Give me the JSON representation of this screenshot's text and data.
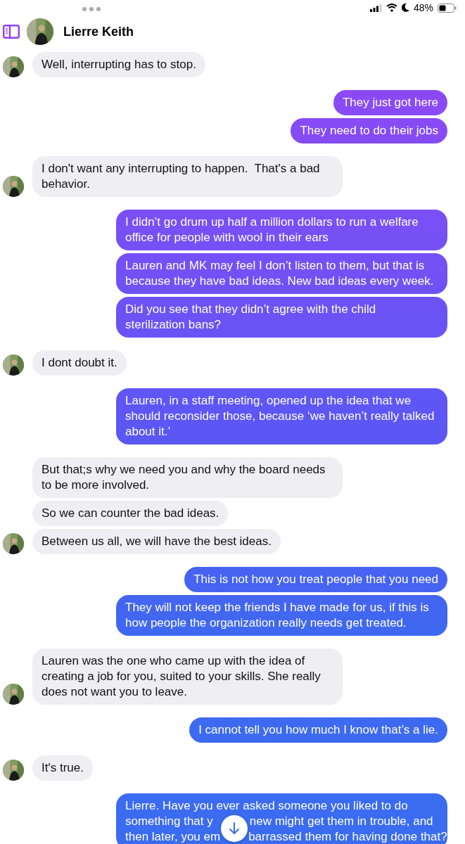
{
  "status_bar": {
    "battery": "48%"
  },
  "header": {
    "name": "Lierre Keith"
  },
  "messages": [
    {
      "kind": "incoming",
      "avatar": true,
      "text": "Well, interrupting has to stop."
    },
    {
      "kind": "outgoing",
      "text": "They just got here"
    },
    {
      "kind": "outgoing",
      "text": "They need to do their jobs"
    },
    {
      "kind": "incoming",
      "avatar": true,
      "text": "I don't want any interrupting to happen.  That's a bad behavior."
    },
    {
      "kind": "outgoing",
      "text": "I didn’t go drum up half a million dollars to run a welfare office for people with wool in their ears"
    },
    {
      "kind": "outgoing",
      "text": "Lauren and MK may feel I don’t listen to them, but that is because they have bad ideas. New bad ideas every week."
    },
    {
      "kind": "outgoing",
      "text": "Did you see that they didn’t agree with the child sterilization bans?"
    },
    {
      "kind": "incoming",
      "avatar": true,
      "text": "I dont doubt it."
    },
    {
      "kind": "outgoing",
      "text": "Lauren, in a staff meeting, opened up the idea that we should reconsider those, because ‘we haven’t really talked about it.’"
    },
    {
      "kind": "incoming",
      "avatar": false,
      "text": "But that;s why we need you and why the board needs to be more involved."
    },
    {
      "kind": "incoming",
      "avatar": false,
      "text": "So we can counter the bad ideas."
    },
    {
      "kind": "incoming",
      "avatar": true,
      "text": "Between us all, we will have the best ideas."
    },
    {
      "kind": "outgoing",
      "text": "This is not how you treat people that you need"
    },
    {
      "kind": "outgoing",
      "text": "They will not keep the friends I have made for us, if this is how people the organization really needs get treated."
    },
    {
      "kind": "incoming",
      "avatar": true,
      "text": "Lauren was the one who came up with the idea of creating a job for you, suited to your skills. She really does not want you to leave."
    },
    {
      "kind": "outgoing",
      "text": "I cannot tell you how much I know that’s a lie."
    },
    {
      "kind": "incoming",
      "avatar": true,
      "text": "It's true."
    },
    {
      "kind": "outgoing",
      "lines": [
        [
          "Lierre. Have you ever asked someone you liked to do"
        ],
        [
          "something that y",
          "new might get them in trouble, and"
        ],
        [
          "then later, you em",
          "barrassed them for having done that?"
        ]
      ]
    }
  ]
}
